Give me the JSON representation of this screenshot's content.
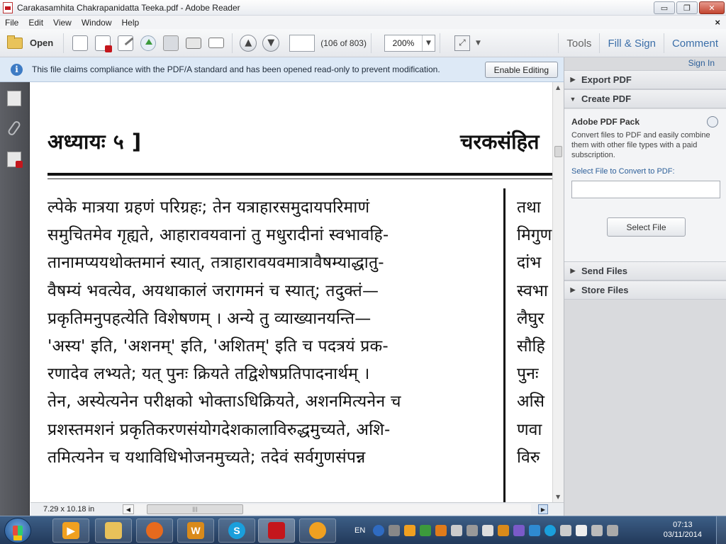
{
  "window": {
    "title": "Carakasamhita Chakrapanidatta Teeka.pdf - Adobe Reader",
    "minimize": "▭",
    "maximize": "❐",
    "close": "✕"
  },
  "menu": {
    "items": [
      "File",
      "Edit",
      "View",
      "Window",
      "Help"
    ],
    "close_doc": "×"
  },
  "toolbar": {
    "open_label": "Open",
    "page_input": "",
    "page_count": "(106 of 803)",
    "zoom": "200%",
    "tools": "Tools",
    "fill_sign": "Fill & Sign",
    "comment": "Comment",
    "prev_glyph": "▲",
    "next_glyph": "▼",
    "icons": [
      "create-pdf-icon",
      "export-pdf-icon",
      "edit-pdf-icon",
      "upload-icon",
      "save-icon",
      "print-icon",
      "email-icon",
      "previous-page-icon",
      "next-page-icon",
      "fit-page-icon",
      "customize-dropdown-icon"
    ]
  },
  "infobar": {
    "message": "This file claims compliance with the PDF/A standard and has been opened read-only to prevent modification.",
    "enable_editing": "Enable Editing"
  },
  "document": {
    "header_left": "अध्यायः ५ ]",
    "header_right": "चरकसंहित",
    "lines": [
      "ल्पेके मात्रया ग्रहणं परिग्रहः; तेन यत्राहारसमुदायपरिमाणं",
      "समुचितमेव गृह्यते, आहारावयवानां तु मधुरादीनां स्वभावहि-",
      "तानामप्ययथोक्तमानं स्यात्, तत्राहारावयवमात्रावैषम्याद्धातु-",
      "वैषम्यं भवत्येव, अयथाकालं जरागमनं च स्यात्; तदुक्तं—",
      "प्रकृतिमनुपहत्येति विशेषणम् । अन्ये तु व्याख्यानयन्ति—",
      "'अस्य' इति, 'अशनम्' इति, 'अशितम्' इति च पदत्रयं प्रक-",
      "रणादेव लभ्यते; यत् पुनः क्रियते तद्विशेषप्रतिपादनार्थम् ।",
      "तेन, अस्येत्यनेन परीक्षको भोक्ताऽधिक्रियते, अशनमित्यनेन च",
      "प्रशस्तमशनं प्रकृतिकरणसंयोगदेशकालाविरुद्धमुच्यते, अशि-",
      "तमित्यनेन च यथाविधिभोजनमुच्यते; तदेवं सर्वगुणसंपन्न"
    ],
    "right_column": [
      "तथा",
      "मिगुण",
      "दांभ",
      "स्वभा",
      "लैघुर",
      "सौहि",
      "पुनः",
      "असि",
      "णवा",
      "विरु"
    ]
  },
  "statusbar": {
    "page_size": "7.29 x 10.18 in",
    "scroll_left": "◀",
    "scroll_right": "▶",
    "thumb_grip": "|||"
  },
  "right_pane": {
    "sign_in": "Sign In",
    "sections": {
      "export_pdf": "Export PDF",
      "create_pdf": "Create PDF",
      "send_files": "Send Files",
      "store_files": "Store Files"
    },
    "expanded_arrow": "▼",
    "collapsed_arrow": "▶",
    "pack_title": "Adobe PDF Pack",
    "pack_desc": "Convert files to PDF and easily combine them with other file types with a paid subscription.",
    "select_label": "Select File to Convert to PDF:",
    "select_button": "Select File"
  },
  "taskbar": {
    "apps": [
      "media-player-icon",
      "file-explorer-icon",
      "firefox-icon",
      "word-icon",
      "skype-icon",
      "adobe-reader-icon",
      "app-flower-icon"
    ],
    "language": "EN",
    "time": "07:13",
    "date": "03/11/2014"
  },
  "colors": {
    "accent_blue": "#3b6ea8",
    "infobar_bg": "#dde9f6",
    "leftnav_bg": "#55575c",
    "taskbar_bg": "#2b4568"
  }
}
